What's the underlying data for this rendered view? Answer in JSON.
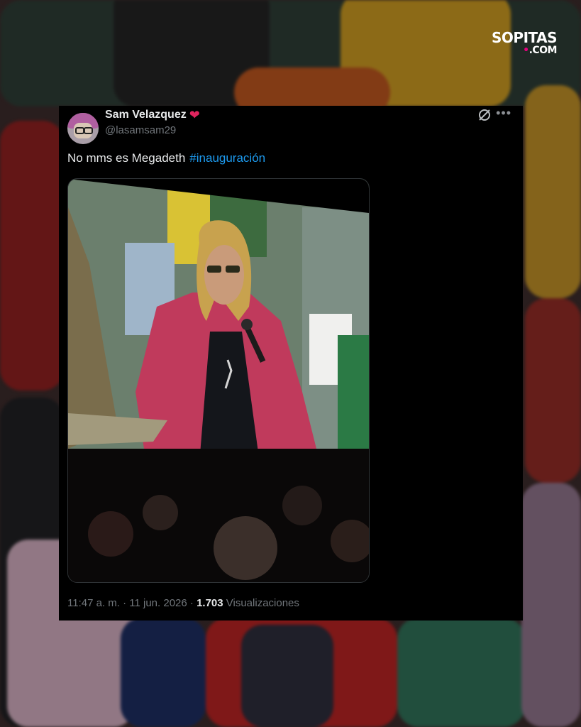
{
  "brand": {
    "name": "SOPITAS",
    "tld": ".COM"
  },
  "tweet": {
    "display_name": "Sam Velazquez",
    "name_emoji": "❤",
    "handle": "@lasamsam29",
    "text": "No mms es Megadeth",
    "hashtag": "#inauguración",
    "time_date": "11:47 a. m. · 11 jun. 2026 · ",
    "views_count": "1.703",
    "views_label": " Visualizaciones",
    "icons": {
      "grok": "grok-icon",
      "more": "more-options-icon",
      "heart": "heart-icon"
    }
  },
  "colors": {
    "hashtag": "#1d9bf0",
    "heart": "#e0245e",
    "brand_dot": "#e6007e"
  }
}
